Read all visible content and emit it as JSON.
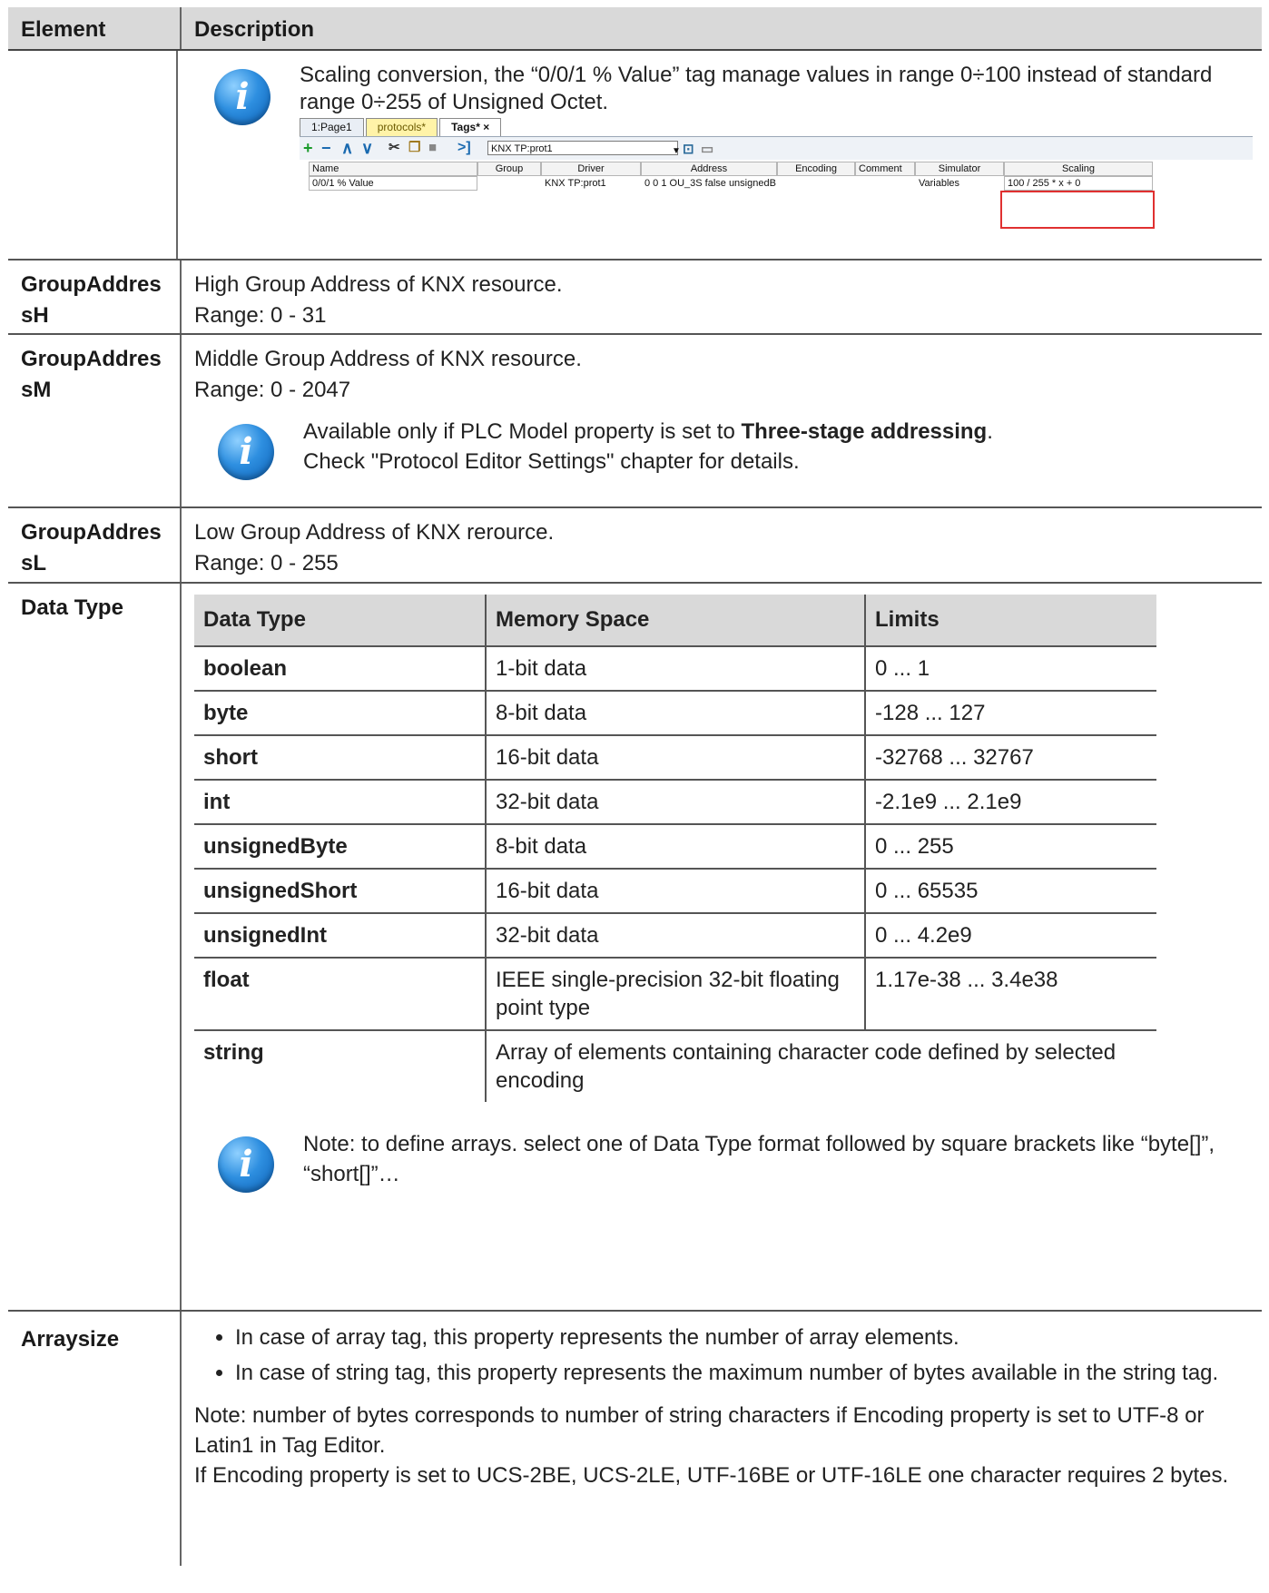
{
  "header": {
    "element": "Element",
    "description": "Description"
  },
  "scaling": {
    "text": "Scaling conversion, the “0/0/1 % Value” tag manage values in range 0÷100 instead of standard range 0÷255 of Unsigned Octet.",
    "tabs": [
      "1:Page1",
      "protocols*",
      "Tags*"
    ],
    "tab_close": "×",
    "toolbar_combo": "KNX TP:prot1",
    "grid_headers": [
      "Name",
      "Group",
      "Driver",
      "Address",
      "Encoding",
      "Comment",
      "Simulator",
      "Scaling"
    ],
    "grid_row": [
      "0/0/1 % Value",
      "",
      "KNX TP:prot1",
      "0 0 1 OU_3S false unsignedB",
      "",
      "",
      "Variables",
      "100 / 255 * x + 0"
    ]
  },
  "rows": {
    "gah": {
      "name": "GroupAddressH",
      "line1": "High Group Address of KNX resource.",
      "line2": "Range: 0 - 31"
    },
    "gam": {
      "name": "GroupAddressM",
      "line1": "Middle Group Address of KNX resource.",
      "line2": "Range: 0 - 2047",
      "note_prefix": "Available only if PLC Model property is set to ",
      "note_bold": "Three-stage addressing",
      "note_suffix": ".",
      "note_line2": "Check \"Protocol Editor Settings\" chapter for details."
    },
    "gal": {
      "name": "GroupAddressL",
      "line1": "Low Group Address of KNX rerource.",
      "line2": "Range: 0 - 255"
    },
    "datatype": {
      "name": "Data Type",
      "headers": [
        "Data Type",
        "Memory Space",
        "Limits"
      ],
      "items": [
        [
          "boolean",
          "1-bit data",
          "0 ... 1"
        ],
        [
          "byte",
          "8-bit data",
          "-128 ... 127"
        ],
        [
          "short",
          "16-bit data",
          "-32768 ... 32767"
        ],
        [
          "int",
          "32-bit data",
          "-2.1e9 ... 2.1e9"
        ],
        [
          "unsignedByte",
          "8-bit data",
          "0 ... 255"
        ],
        [
          "unsignedShort",
          "16-bit data",
          "0 ... 65535"
        ],
        [
          "unsignedInt",
          "32-bit data",
          "0 ... 4.2e9"
        ],
        [
          "float",
          "IEEE single-precision 32-bit floating point type",
          "1.17e-38 ... 3.4e38"
        ]
      ],
      "string_row": [
        "string",
        "Array of elements containing character code defined by selected encoding"
      ],
      "note": "Note: to define arrays. select one of Data Type format followed by square brackets like “byte[]”, “short[]”…"
    },
    "arraysize": {
      "name": "Arraysize",
      "bullets": [
        "In case of array tag, this property represents the number of array elements.",
        "In case of string tag, this property represents the maximum number of bytes available in the string tag."
      ],
      "note1": "Note: number of bytes corresponds to number of string characters if Encoding property is set to UTF-8 or Latin1 in Tag Editor.",
      "note2": "If Encoding property is set to UCS-2BE, UCS-2LE, UTF-16BE or UTF-16LE one character requires 2 bytes."
    }
  },
  "icons": {
    "info": "info-icon",
    "info_glyph": "i"
  },
  "colors": {
    "header_bg": "#d9d9d9",
    "info_blue": "#2e8fe0",
    "highlight_red": "#e03030",
    "protocols_tab": "#fff3a8"
  }
}
